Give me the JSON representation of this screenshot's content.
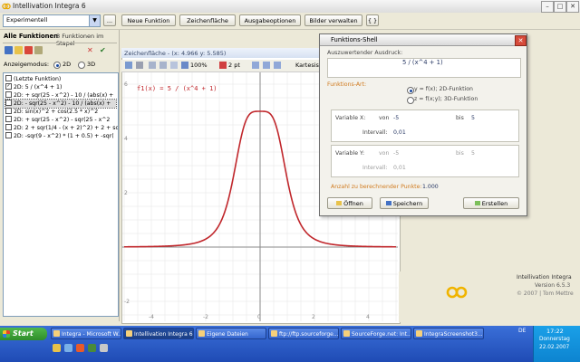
{
  "window": {
    "title": "Intellivation Integra 6",
    "minimize": "–",
    "maximize": "□",
    "close": "✕"
  },
  "toolbar": {
    "combo_value": "Experimentell",
    "more": "...",
    "neue_funktion": "Neue Funktion",
    "zeichenflaeche": "Zeichenfläche",
    "ausgabeoptionen": "Ausgabeoptionen",
    "bilder_verwalten": "Bilder verwalten",
    "braces": "{ }"
  },
  "left_panel": {
    "title": "Alle Funktionen",
    "count": "8 Funktionen im Stapel",
    "close": "✕",
    "check": "✔",
    "display_label": "Anzeigemodus:",
    "mode_2d": "2D",
    "mode_3d": "3D",
    "functions": [
      "(Letzte Funktion)",
      "2D: 5 / (x^4 + 1)",
      "2D: + sqr(25 - x^2) - 10 / (abs(x) +",
      "2D: - sqr(25 - x^2) - 10 / (abs(x) +",
      "2D: sin(x)^2 + cos(2.5 * x)^2",
      "2D: + sqr(25 - x^2) - sqr(25 - x^2",
      "2D: 2 + sqr(1/4 - (x + 2)^2) + 2 + sq",
      "2D: -sqr(9 - x^2) * (1 + 0.5) + -sqr("
    ],
    "checked": [
      false,
      true,
      false,
      false,
      false,
      false,
      false,
      false
    ],
    "selected_index": 3
  },
  "canvas": {
    "title": "Zeichenfläche - (x: 4.966 y: 5.585)",
    "zoom": "100%",
    "line_width": "2 pt",
    "coord_mode": "Kartesisch",
    "function_label": "f1(x) = 5 / (x^4 + 1)",
    "curve_color": "#c0262b",
    "x_ticks": [
      "-4",
      "-2",
      "0",
      "2",
      "4"
    ],
    "y_ticks": [
      "6",
      "4",
      "2",
      "-2"
    ]
  },
  "dialog": {
    "title": "Funktions-Shell",
    "close": "✕",
    "expr_label": "Auszuwertender Ausdruck:",
    "expression": "5 / (x^4 + 1)",
    "type_label": "Funktions-Art:",
    "opt_2d": "y = f(x); 2D-Funktion",
    "opt_3d": "z = f(x;y); 3D-Funktion",
    "var_x_label": "Variable X:",
    "von": "von",
    "bis": "bis",
    "x_from": "-5",
    "x_to": "5",
    "interval_label": "Intervall:",
    "x_interval": "0,01",
    "var_y_label": "Variable Y:",
    "y_from": "-5",
    "y_to": "5",
    "y_interval": "0,01",
    "points_label": "Anzahl zu berechnender Punkte:",
    "points_value": "1.000",
    "open": "Öffnen",
    "save": "Speichern",
    "create": "Erstellen"
  },
  "branding": {
    "name": "Intellivation Integra",
    "version": "Version 6.5.3",
    "copyright": "© 2007 | Tom Mettre"
  },
  "taskbar": {
    "start": "Start",
    "tasks": [
      "Integra - Microsoft W...",
      "Intellivation Integra 6",
      "Eigene Dateien",
      "ftp://ftp.sourceforge...",
      "SourceForge.net: Int...",
      "IntegraScreenshot3...."
    ],
    "active_index": 1,
    "lang": "DE",
    "time": "17:22",
    "day": "Donnerstag",
    "date": "22.02.2007"
  }
}
